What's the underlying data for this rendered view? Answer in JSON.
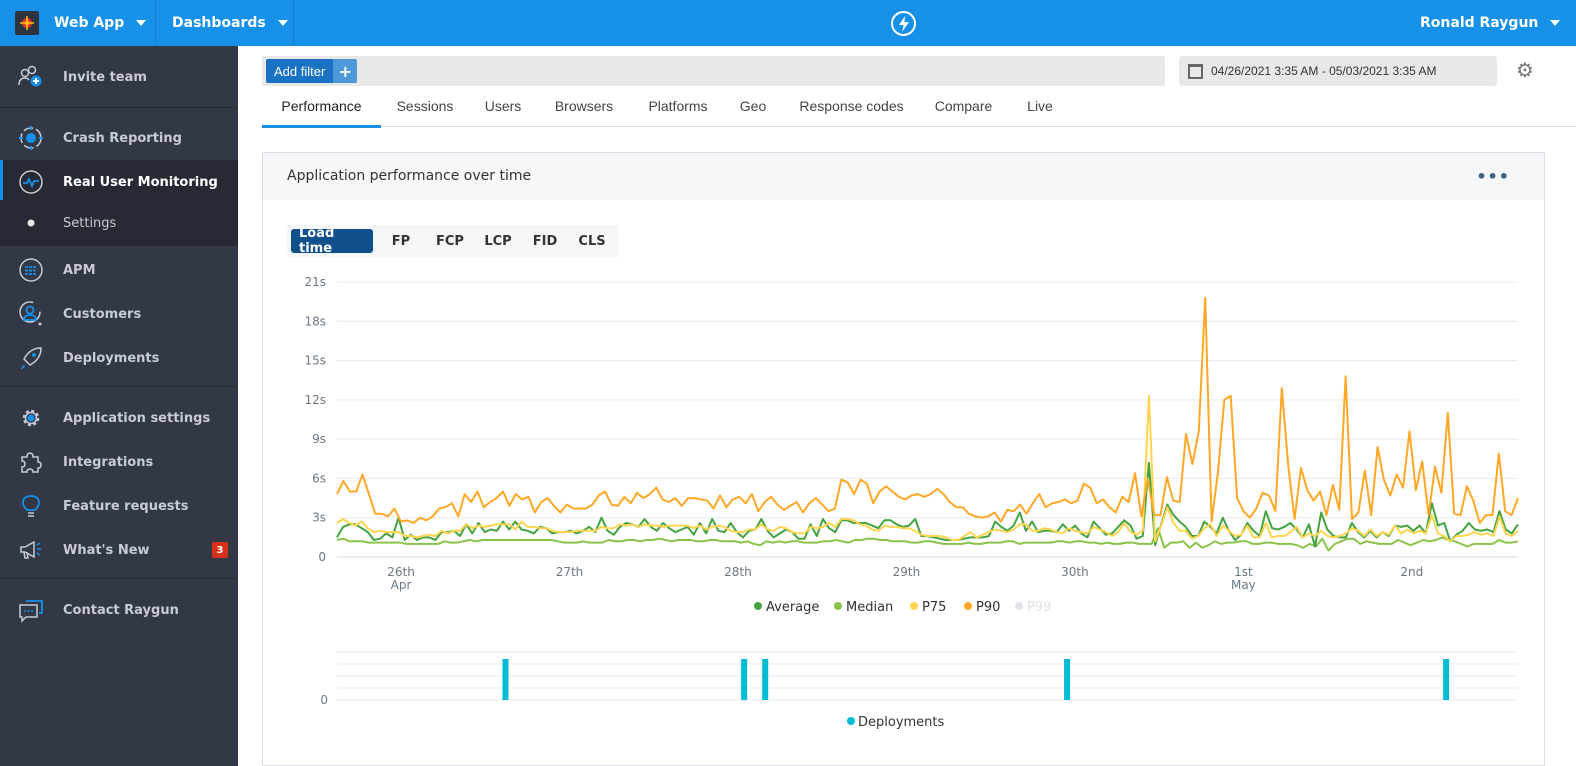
{
  "topbar": {
    "app_name": "Web App",
    "dashboards": "Dashboards",
    "user": "Ronald Raygun",
    "color": "#1690e8"
  },
  "sidebar": {
    "items": [
      {
        "label": "Invite team",
        "icon": "invite-team-icon"
      },
      {
        "label": "Crash Reporting",
        "icon": "bug-icon"
      },
      {
        "label": "Real User Monitoring",
        "icon": "pulse-icon",
        "active": true
      },
      {
        "label": "Settings",
        "icon": "bullet-icon",
        "sub": true
      },
      {
        "label": "APM",
        "icon": "apm-icon"
      },
      {
        "label": "Customers",
        "icon": "customers-icon"
      },
      {
        "label": "Deployments",
        "icon": "rocket-icon"
      },
      {
        "label": "Application settings",
        "icon": "gear-icon"
      },
      {
        "label": "Integrations",
        "icon": "puzzle-icon"
      },
      {
        "label": "Feature requests",
        "icon": "lightbulb-icon"
      },
      {
        "label": "What's New",
        "icon": "megaphone-icon",
        "badge": "3"
      },
      {
        "label": "Contact Raygun",
        "icon": "chat-icon"
      }
    ]
  },
  "filter": {
    "add_label": "Add filter",
    "plus": "+"
  },
  "date_range": "04/26/2021 3:35 AM - 05/03/2021 3:35 AM",
  "tabs": [
    "Performance",
    "Sessions",
    "Users",
    "Browsers",
    "Platforms",
    "Geo",
    "Response codes",
    "Compare",
    "Live"
  ],
  "active_tab": "Performance",
  "card": {
    "title": "Application performance over time",
    "more": "•••",
    "metric_tabs": [
      "Load time",
      "FP",
      "FCP",
      "LCP",
      "FID",
      "CLS"
    ],
    "active_metric": "Load time"
  },
  "chart_data": [
    {
      "type": "line",
      "title": "Application performance over time",
      "ylabel": "",
      "xlabel": "",
      "ylim": [
        0,
        21
      ],
      "y_ticks": [
        "0",
        "3s",
        "6s",
        "9s",
        "12s",
        "15s",
        "18s",
        "21s"
      ],
      "y_tick_values": [
        0,
        3,
        6,
        9,
        12,
        15,
        18,
        21
      ],
      "x_ticks": [
        {
          "label": "26th",
          "sub": "Apr",
          "day": 0
        },
        {
          "label": "27th",
          "sub": "",
          "day": 1
        },
        {
          "label": "28th",
          "sub": "",
          "day": 2
        },
        {
          "label": "29th",
          "sub": "",
          "day": 3
        },
        {
          "label": "30th",
          "sub": "",
          "day": 4
        },
        {
          "label": "1st",
          "sub": "May",
          "day": 5
        },
        {
          "label": "2nd",
          "sub": "",
          "day": 6
        }
      ],
      "x_range_days": [
        -0.38,
        6.63
      ],
      "grid": true,
      "legend_position": "bottom",
      "series": [
        {
          "name": "Average",
          "color": "#43a340",
          "visible": true,
          "values": [
            1.5,
            2.3,
            2.5,
            2.5,
            2.2,
            1.9,
            1.3,
            1.4,
            1.8,
            1.5,
            3.0,
            1.3,
            1.7,
            1.3,
            1.5,
            1.5,
            1.3,
            1.9,
            1.9,
            2.0,
            1.6,
            2.5,
            1.8,
            2.6,
            1.9,
            2.1,
            2.0,
            2.7,
            2.1,
            2.7,
            2.1,
            2.0,
            1.8,
            2.3,
            2.2,
            1.8,
            1.9,
            1.9,
            2.0,
            1.8,
            2.0,
            2.3,
            1.9,
            3.0,
            2.0,
            1.7,
            2.3,
            2.6,
            2.5,
            2.3,
            2.9,
            2.3,
            2.0,
            2.6,
            2.2,
            1.9,
            2.1,
            2.3,
            1.7,
            2.6,
            1.8,
            2.9,
            2.0,
            1.9,
            2.6,
            1.9,
            1.5,
            2.0,
            2.1,
            2.9,
            2.0,
            1.5,
            1.8,
            2.1,
            1.9,
            1.4,
            1.4,
            2.5,
            1.6,
            2.9,
            2.2,
            1.9,
            2.8,
            2.8,
            2.6,
            2.6,
            2.6,
            2.4,
            2.2,
            2.8,
            2.8,
            2.5,
            2.3,
            2.4,
            2.9,
            1.6,
            1.6,
            1.5,
            1.4,
            1.3,
            1.3,
            1.3,
            1.4,
            1.5,
            1.5,
            1.5,
            1.6,
            2.7,
            2.3,
            2.0,
            2.4,
            3.4,
            2.0,
            2.7,
            1.9,
            2.0,
            2.0,
            1.9,
            2.5,
            2.0,
            2.4,
            1.8,
            1.5,
            2.7,
            2.2,
            1.7,
            1.8,
            2.3,
            2.8,
            2.4,
            1.4,
            1.6,
            7.2,
            0.9,
            2.5,
            4.0,
            3.2,
            2.7,
            2.3,
            1.6,
            1.6,
            2.7,
            2.3,
            1.8,
            3.0,
            2.0,
            1.3,
            1.7,
            2.6,
            2.0,
            1.6,
            3.5,
            2.2,
            2.1,
            2.3,
            2.6,
            2.1,
            1.5,
            2.5,
            0.8,
            3.4,
            2.1,
            1.6,
            1.5,
            1.5,
            2.6,
            1.9,
            1.5,
            2.0,
            1.5,
            1.9,
            1.6,
            2.4,
            2.3,
            2.4,
            2.0,
            2.4,
            1.8,
            4.1,
            2.4,
            2.6,
            1.2,
            1.7,
            2.0,
            2.6,
            2.1,
            2.0,
            2.1,
            1.9,
            3.5,
            2.1,
            1.8,
            2.5
          ]
        },
        {
          "name": "Median",
          "color": "#8bc34a",
          "visible": true,
          "values": [
            1.3,
            1.4,
            1.2,
            1.2,
            1.2,
            1.1,
            1.1,
            1.1,
            1.1,
            1.1,
            1.1,
            1.0,
            1.0,
            1.0,
            1.0,
            1.0,
            1.0,
            1.2,
            1.1,
            1.1,
            1.2,
            1.3,
            1.2,
            1.3,
            1.3,
            1.3,
            1.3,
            1.3,
            1.3,
            1.3,
            1.3,
            1.3,
            1.3,
            1.3,
            1.3,
            1.2,
            1.1,
            1.1,
            1.1,
            1.2,
            1.1,
            1.1,
            1.1,
            1.3,
            1.2,
            1.2,
            1.3,
            1.3,
            1.2,
            1.3,
            1.3,
            1.4,
            1.3,
            1.2,
            1.3,
            1.3,
            1.3,
            1.2,
            1.2,
            1.3,
            1.3,
            1.2,
            1.2,
            1.2,
            1.1,
            1.2,
            1.0,
            0.9,
            1.2,
            1.1,
            1.2,
            1.1,
            1.2,
            1.2,
            1.1,
            1.1,
            1.1,
            1.2,
            1.2,
            1.3,
            1.2,
            1.1,
            1.3,
            1.3,
            1.4,
            1.4,
            1.3,
            1.3,
            1.2,
            1.2,
            1.2,
            1.1,
            1.1,
            1.2,
            1.2,
            1.1,
            1.0,
            1.0,
            1.0,
            1.0,
            1.1,
            1.0,
            1.0,
            1.1,
            1.1,
            1.1,
            1.2,
            1.2,
            1.0,
            1.1,
            1.1,
            1.1,
            1.1,
            1.1,
            1.2,
            1.2,
            1.1,
            1.2,
            1.2,
            1.1,
            1.1,
            1.0,
            1.1,
            1.0,
            1.0,
            1.1,
            1.1,
            1.0,
            1.0,
            1.0,
            2.2,
            0.7,
            1.1,
            1.1,
            1.2,
            0.7,
            1.1,
            0.7,
            0.9,
            1.2,
            1.0,
            1.1,
            1.1,
            1.2,
            1.2,
            1.0,
            1.0,
            1.1,
            1.1,
            1.0,
            1.0,
            1.0,
            0.9,
            0.7,
            1.0,
            0.8,
            1.4,
            0.5,
            1.0,
            1.2,
            1.4,
            1.4,
            1.0,
            1.2,
            1.1,
            1.0,
            1.0,
            1.0,
            1.3,
            1.1,
            0.9,
            1.1,
            1.3,
            1.2,
            1.3,
            1.5,
            1.3,
            1.2,
            1.0,
            0.8,
            1.0,
            1.0,
            1.0,
            1.0,
            1.3,
            1.1,
            1.1,
            1.2
          ]
        },
        {
          "name": "P75",
          "color": "#ffd54f",
          "visible": true,
          "values": [
            2.6,
            2.9,
            2.6,
            2.4,
            2.7,
            2.2,
            1.9,
            2.0,
            1.9,
            1.9,
            1.9,
            1.6,
            1.6,
            1.5,
            1.6,
            1.7,
            1.6,
            2.0,
            1.8,
            2.0,
            2.0,
            2.5,
            2.2,
            2.4,
            2.3,
            2.4,
            2.5,
            2.5,
            2.5,
            2.1,
            2.7,
            2.3,
            2.3,
            2.2,
            2.2,
            2.0,
            1.9,
            1.9,
            1.9,
            2.0,
            2.0,
            2.0,
            2.0,
            2.3,
            2.2,
            2.2,
            2.5,
            2.4,
            2.5,
            2.3,
            2.5,
            2.4,
            2.4,
            2.3,
            2.4,
            2.4,
            2.4,
            2.4,
            2.2,
            2.4,
            2.1,
            2.3,
            2.4,
            2.3,
            2.0,
            1.9,
            1.9,
            2.1,
            2.1,
            2.5,
            2.1,
            2.0,
            2.3,
            2.2,
            1.9,
            1.8,
            1.8,
            2.3,
            2.2,
            2.3,
            2.6,
            2.3,
            2.9,
            2.9,
            2.8,
            2.5,
            2.4,
            2.1,
            2.0,
            2.4,
            2.3,
            2.3,
            2.2,
            2.2,
            2.0,
            1.7,
            1.6,
            1.6,
            1.6,
            1.5,
            1.3,
            1.3,
            1.6,
            1.9,
            1.5,
            1.7,
            1.9,
            2.1,
            2.0,
            1.9,
            2.1,
            2.5,
            2.5,
            2.0,
            2.0,
            2.2,
            2.1,
            1.9,
            1.8,
            2.2,
            2.0,
            1.9,
            1.8,
            2.3,
            2.1,
            1.9,
            1.6,
            1.9,
            2.6,
            1.9,
            1.7,
            2.0,
            12.3,
            1.2,
            2.4,
            3.8,
            2.6,
            2.0,
            2.0,
            1.4,
            1.6,
            2.2,
            2.5,
            1.6,
            2.4,
            2.0,
            1.6,
            1.7,
            2.4,
            1.5,
            1.5,
            2.6,
            1.5,
            1.6,
            1.6,
            1.9,
            2.3,
            1.5,
            1.8,
            1.6,
            2.0,
            1.6,
            1.5,
            1.6,
            1.8,
            2.2,
            2.0,
            1.6,
            2.1,
            1.6,
            1.9,
            1.7,
            2.4,
            1.8,
            2.1,
            1.8,
            2.0,
            1.8,
            3.2,
            1.8,
            1.6,
            1.2,
            1.6,
            1.6,
            1.7,
            1.9,
            1.7,
            1.8,
            1.6,
            3.1,
            1.8,
            1.6,
            2.0
          ]
        },
        {
          "name": "P90",
          "color": "#ffa726",
          "visible": true,
          "values": [
            4.8,
            5.8,
            5.0,
            5.0,
            6.3,
            4.8,
            3.3,
            3.3,
            3.1,
            3.7,
            2.7,
            2.8,
            2.6,
            3.0,
            2.8,
            3.1,
            3.7,
            3.8,
            4.1,
            3.1,
            4.8,
            4.2,
            5.0,
            3.8,
            4.2,
            4.5,
            5.0,
            3.9,
            4.8,
            4.4,
            4.6,
            3.4,
            4.2,
            4.5,
            3.9,
            3.4,
            4.0,
            3.7,
            3.7,
            3.7,
            4.0,
            4.7,
            5.0,
            4.0,
            3.9,
            4.6,
            4.1,
            4.9,
            4.5,
            4.8,
            5.3,
            4.4,
            4.2,
            4.5,
            3.9,
            4.5,
            4.5,
            4.4,
            4.3,
            3.7,
            4.7,
            3.8,
            4.4,
            4.6,
            4.1,
            4.8,
            3.5,
            4.2,
            4.6,
            4.0,
            3.6,
            3.9,
            4.2,
            3.4,
            4.1,
            4.5,
            4.0,
            3.5,
            3.7,
            5.9,
            5.7,
            4.8,
            5.9,
            5.6,
            4.1,
            5.0,
            5.4,
            5.0,
            4.6,
            4.4,
            4.7,
            4.8,
            4.6,
            4.8,
            5.2,
            4.8,
            4.2,
            3.8,
            3.8,
            3.3,
            3.1,
            3.0,
            3.1,
            3.4,
            2.7,
            3.6,
            3.5,
            4.0,
            3.3,
            4.1,
            4.8,
            3.8,
            4.1,
            4.2,
            4.4,
            4.1,
            4.3,
            5.6,
            5.3,
            4.1,
            4.4,
            3.8,
            3.4,
            4.6,
            4.2,
            6.4,
            3.1,
            6.0,
            3.2,
            3.2,
            6.1,
            4.3,
            4.2,
            9.4,
            7.1,
            9.6,
            19.8,
            2.7,
            6.5,
            12.0,
            12.3,
            4.5,
            3.5,
            3.0,
            3.7,
            4.9,
            4.7,
            3.5,
            12.9,
            7.0,
            2.9,
            6.8,
            5.1,
            4.3,
            5.0,
            3.2,
            5.5,
            3.6,
            13.8,
            2.9,
            3.4,
            6.6,
            3.2,
            8.4,
            5.9,
            4.7,
            6.3,
            5.3,
            9.6,
            5.1,
            7.3,
            3.2,
            6.9,
            4.9,
            11.0,
            3.3,
            3.2,
            5.4,
            4.3,
            2.6,
            3.2,
            3.2,
            7.9,
            3.5,
            3.2,
            4.5
          ]
        },
        {
          "name": "P99",
          "color": "#e0e3e8",
          "visible": false,
          "values": []
        }
      ]
    },
    {
      "type": "bar",
      "title": "Deployments",
      "ylim": [
        0,
        1
      ],
      "y_ticks": [
        "0"
      ],
      "legend_position": "bottom",
      "series": [
        {
          "name": "Deployments",
          "color": "#00bcd4",
          "hours": [
            24,
            58,
            61,
            104,
            158
          ]
        }
      ]
    }
  ]
}
